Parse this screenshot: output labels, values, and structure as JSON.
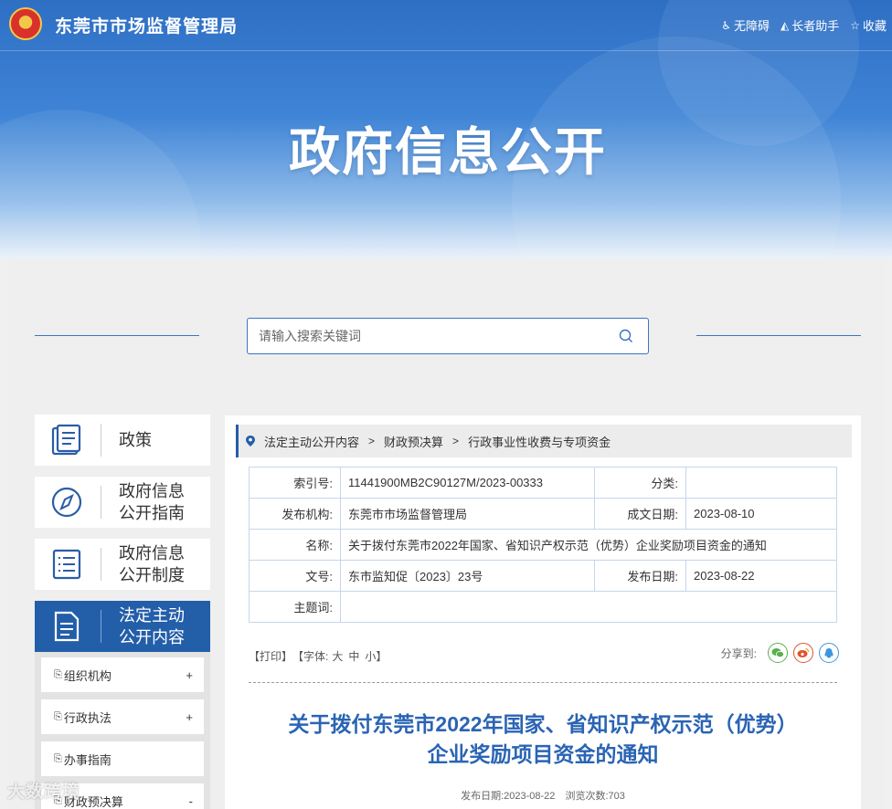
{
  "header": {
    "site_title": "东莞市市场监督管理局",
    "links": [
      {
        "icon": "accessibility-icon",
        "label": "无障碍"
      },
      {
        "icon": "elder-assist-icon",
        "label": "长者助手"
      },
      {
        "icon": "star-icon",
        "label": "收藏"
      }
    ],
    "hero_title": "政府信息公开"
  },
  "search": {
    "placeholder": "请输入搜索关键词"
  },
  "sidebar": {
    "cards": [
      {
        "icon": "policy-book-icon",
        "label": "政策"
      },
      {
        "icon": "compass-icon",
        "label": "政府信息公开指南"
      },
      {
        "icon": "list-document-icon",
        "label": "政府信息公开制度"
      },
      {
        "icon": "document-icon",
        "label": "法定主动公开内容",
        "active": true
      }
    ],
    "sub_items": [
      {
        "label": "组织机构",
        "toggle": "+"
      },
      {
        "label": "行政执法",
        "toggle": "+"
      },
      {
        "label": "办事指南",
        "toggle": ""
      },
      {
        "label": "财政预决算",
        "toggle": "-"
      }
    ]
  },
  "breadcrumb": [
    "法定主动公开内容",
    "财政预决算",
    "行政事业性收费与专项资金"
  ],
  "meta": {
    "index_label": "索引号:",
    "index_value": "11441900MB2C90127M/2023-00333",
    "category_label": "分类:",
    "category_value": "",
    "publisher_label": "发布机构:",
    "publisher_value": "东莞市市场监督管理局",
    "created_label": "成文日期:",
    "created_value": "2023-08-10",
    "name_label": "名称:",
    "name_value": "关于拨付东莞市2022年国家、省知识产权示范（优势）企业奖励项目资金的通知",
    "docno_label": "文号:",
    "docno_value": "东市监知促〔2023〕23号",
    "pubdate_label": "发布日期:",
    "pubdate_value": "2023-08-22",
    "subject_label": "主题词:",
    "subject_value": ""
  },
  "tools": {
    "print": "【打印】",
    "font_prefix": "【字体:",
    "font_large": "大",
    "font_medium": "中",
    "font_small": "小",
    "font_suffix": "】"
  },
  "share": {
    "label": "分享到:",
    "icons": [
      "wechat-icon",
      "weibo-icon",
      "qq-icon"
    ]
  },
  "article": {
    "title_line1": "关于拨付东莞市2022年国家、省知识产权示范（优势）",
    "title_line2": "企业奖励项目资金的通知",
    "pub_date_label": "发布日期:",
    "pub_date": "2023-08-22",
    "views_label": "浏览次数:",
    "views": "703"
  },
  "watermark": "大数跨境"
}
